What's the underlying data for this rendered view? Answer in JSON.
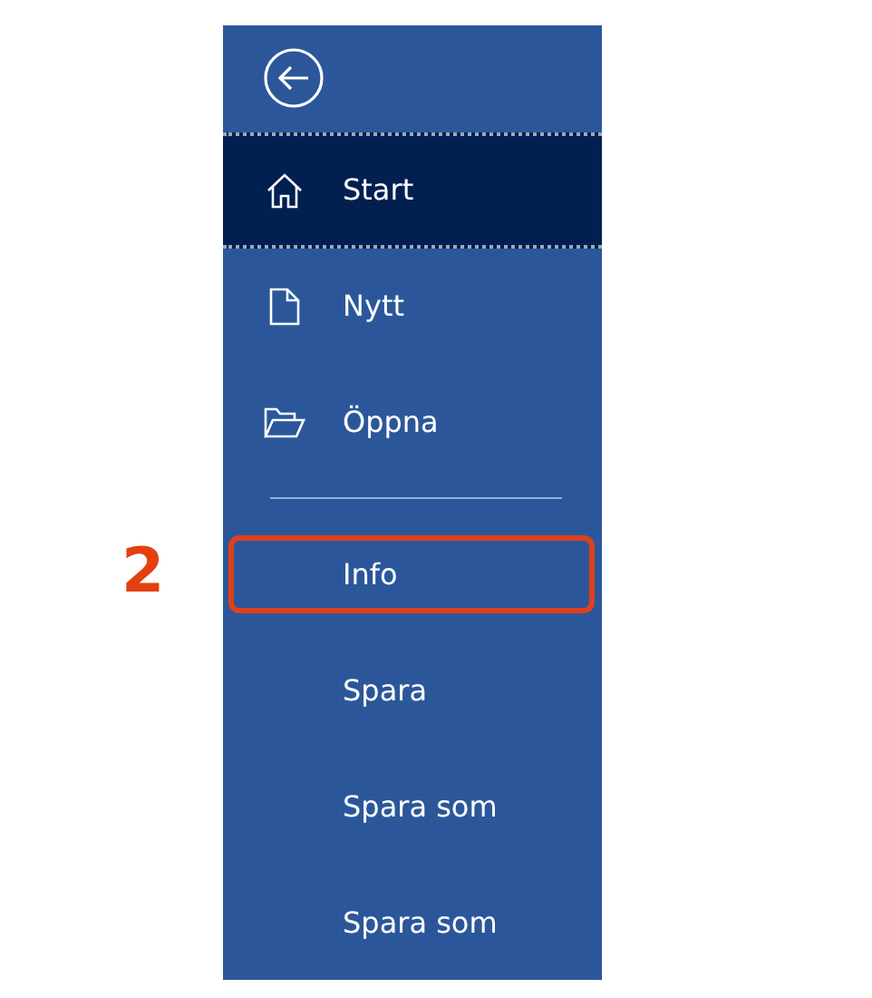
{
  "menu": {
    "items": [
      {
        "kind": "home",
        "label": "Start",
        "selected": true,
        "marked": false
      },
      {
        "kind": "document",
        "label": "Nytt",
        "selected": false,
        "marked": false
      },
      {
        "kind": "folder",
        "label": "Öppna",
        "selected": false,
        "marked": false
      },
      {
        "kind": "divider"
      },
      {
        "kind": "plain",
        "label": "Info",
        "selected": false,
        "marked": true
      },
      {
        "kind": "plain",
        "label": "Spara",
        "selected": false,
        "marked": false
      },
      {
        "kind": "plain",
        "label": "Spara som",
        "selected": false,
        "marked": false
      },
      {
        "kind": "plain",
        "label": "Spara som",
        "selected": false,
        "marked": false
      }
    ]
  },
  "callout_label": "2"
}
